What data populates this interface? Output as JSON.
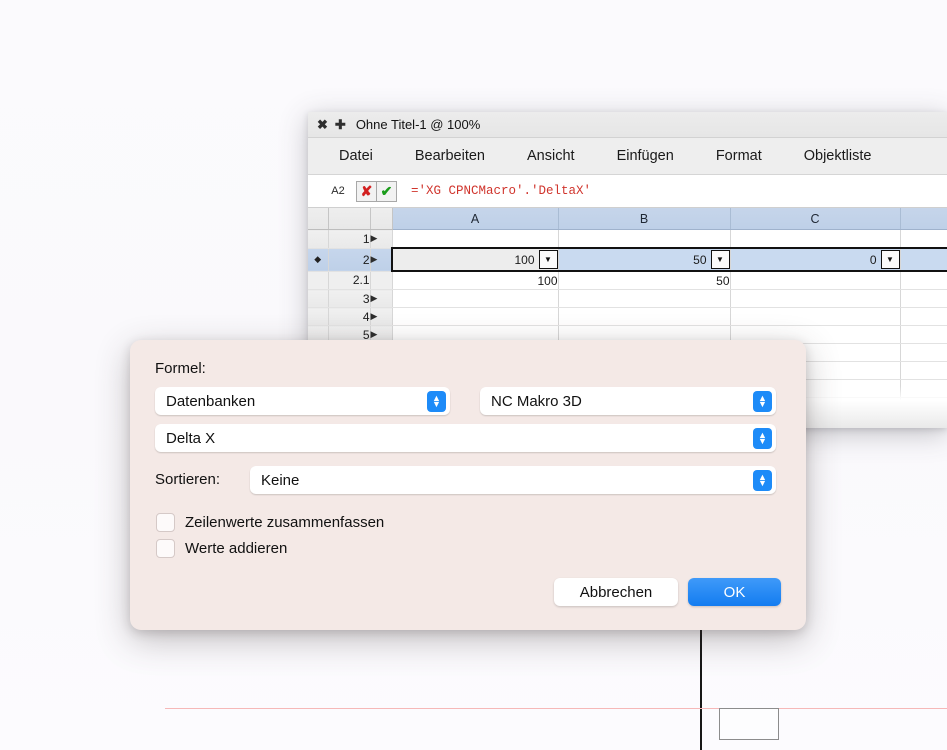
{
  "window": {
    "title": "Ohne Titel-1 @ 100%",
    "close_icon": "close-icon",
    "add_icon": "plus-icon",
    "menu": [
      {
        "label": "Datei"
      },
      {
        "label": "Bearbeiten"
      },
      {
        "label": "Ansicht"
      },
      {
        "label": "Einfügen"
      },
      {
        "label": "Format"
      },
      {
        "label": "Objektliste"
      }
    ],
    "formula_bar": {
      "cell_ref": "A2",
      "cancel_glyph": "✘",
      "accept_glyph": "✔",
      "formula": "='XG CPNCMacro'.'DeltaX'"
    }
  },
  "sheet": {
    "columns": [
      "A",
      "B",
      "C",
      ""
    ],
    "rows": [
      {
        "marker": "",
        "num": "1",
        "arrow": "▶",
        "cells": [
          "",
          "",
          "",
          ""
        ]
      },
      {
        "marker": "◆",
        "num": "2",
        "arrow": "▶",
        "cells": [
          "100",
          "50",
          "0",
          ""
        ]
      },
      {
        "marker": "",
        "num": "2.1",
        "arrow": "",
        "cells": [
          "100",
          "50",
          "",
          ""
        ]
      },
      {
        "marker": "",
        "num": "3",
        "arrow": "▶",
        "cells": [
          "",
          "",
          "",
          ""
        ]
      },
      {
        "marker": "",
        "num": "4",
        "arrow": "▶",
        "cells": [
          "",
          "",
          "",
          ""
        ]
      },
      {
        "marker": "",
        "num": "5",
        "arrow": "▶",
        "cells": [
          "",
          "",
          "",
          ""
        ]
      }
    ],
    "dropdown_glyph": "▼"
  },
  "dialog": {
    "formel_label": "Formel:",
    "database_value": "Datenbanken",
    "macro_value": "NC Makro 3D",
    "field_value": "Delta X",
    "sortieren_label": "Sortieren:",
    "sort_value": "Keine",
    "checkbox_1_label": "Zeilenwerte zusammenfassen",
    "checkbox_2_label": "Werte addieren",
    "cancel_label": "Abbrechen",
    "ok_label": "OK",
    "accent_color": "#137cf0",
    "background_color": "#f4e9e6"
  }
}
